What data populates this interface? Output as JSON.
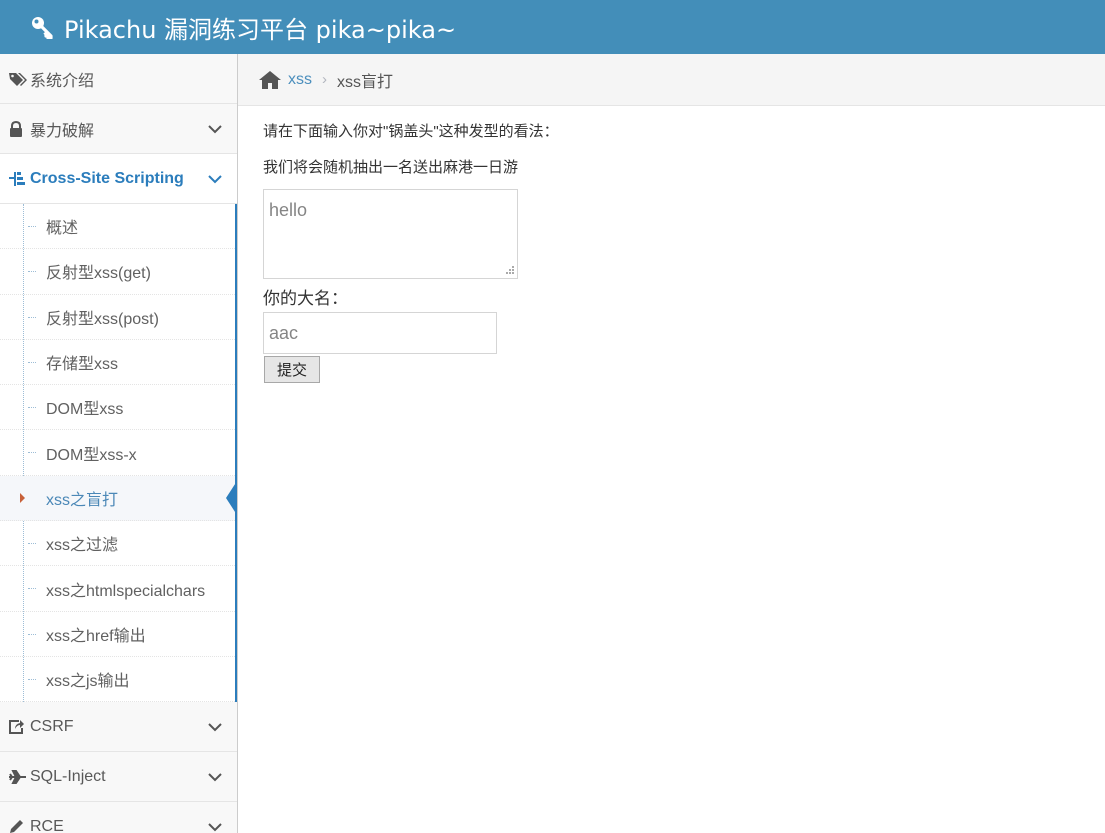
{
  "header": {
    "title": "Pikachu 漏洞练习平台 pika~pika~",
    "icon": "key-icon",
    "color": "#438eb9"
  },
  "sidebar": {
    "items": [
      {
        "label": "系统介绍",
        "icon": "tags-icon"
      },
      {
        "label": "暴力破解",
        "icon": "lock-icon"
      },
      {
        "label": "Cross-Site Scripting",
        "icon": "sitemap-icon",
        "active": true
      },
      {
        "label": "CSRF",
        "icon": "share-square-icon"
      },
      {
        "label": "SQL-Inject",
        "icon": "plane-icon"
      },
      {
        "label": "RCE",
        "icon": "pencil-icon"
      }
    ],
    "xss_submenu": [
      {
        "label": "概述"
      },
      {
        "label": "反射型xss(get)"
      },
      {
        "label": "反射型xss(post)"
      },
      {
        "label": "存储型xss"
      },
      {
        "label": "DOM型xss"
      },
      {
        "label": "DOM型xss-x"
      },
      {
        "label": "xss之盲打",
        "current": true
      },
      {
        "label": "xss之过滤"
      },
      {
        "label": "xss之htmlspecialchars"
      },
      {
        "label": "xss之href输出"
      },
      {
        "label": "xss之js输出"
      }
    ]
  },
  "breadcrumb": {
    "home_icon": "home-icon",
    "link": "xss",
    "separator": "›",
    "current": "xss盲打"
  },
  "form": {
    "prompt": "请在下面输入你对\"锅盖头\"这种发型的看法：",
    "note": "我们将会随机抽出一名送出麻港一日游",
    "textarea_value": "hello",
    "name_label": "你的大名：",
    "name_value": "aac",
    "submit_label": "提交"
  }
}
